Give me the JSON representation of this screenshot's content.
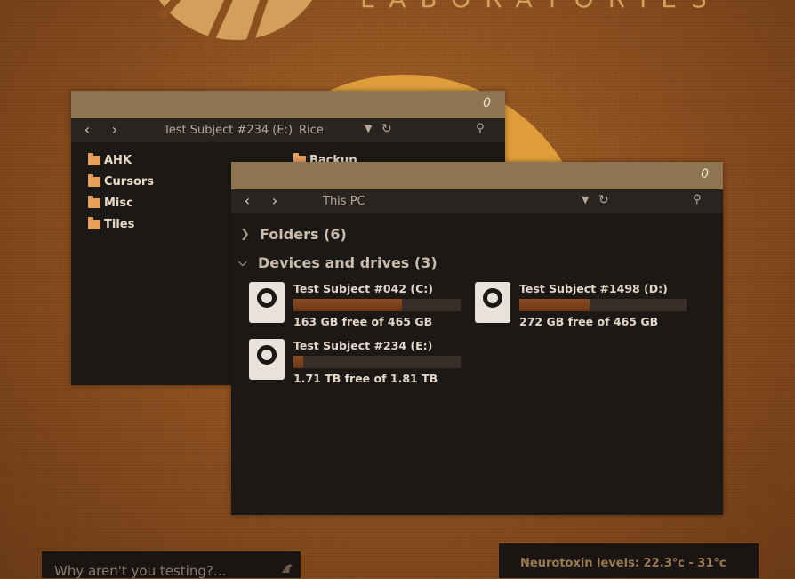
{
  "brand": {
    "wordmark": "LABORATORIES"
  },
  "window_back": {
    "count": "0",
    "breadcrumb": [
      "Test Subject #234 (E:)",
      "Rice"
    ],
    "folders": [
      "AHK",
      "Cursors",
      "Misc",
      "Tiles",
      "Backup"
    ]
  },
  "window_front": {
    "count": "0",
    "breadcrumb": [
      "This PC"
    ],
    "sections": {
      "folders": "Folders (6)",
      "devices": "Devices and drives (3)"
    },
    "drives": [
      {
        "name": "Test Subject #042 (C:)",
        "free": "163 GB free of 465 GB",
        "used_fraction": 0.65
      },
      {
        "name": "Test Subject #1498 (D:)",
        "free": "272 GB free of 465 GB",
        "used_fraction": 0.42
      },
      {
        "name": "Test Subject #234 (E:)",
        "free": "1.71 TB free of 1.81 TB",
        "used_fraction": 0.06
      }
    ]
  },
  "widgets": {
    "prompt_placeholder": "Why aren't you testing?...",
    "neurotoxin": "Neurotoxin levels: 22.3°c - 31°c"
  },
  "icons": {
    "back": "chevron-left-icon",
    "forward": "chevron-right-icon",
    "dropdown": "chevron-down-icon",
    "refresh": "refresh-icon",
    "search": "search-icon",
    "folder": "folder-icon",
    "drive": "hard-drive-icon"
  },
  "colors": {
    "titlebar": "#8e7552",
    "window_bg": "#1c1816",
    "folder": "#e7a15b",
    "drive_fill": "#8a4b24",
    "sun": "#e4a23c"
  }
}
